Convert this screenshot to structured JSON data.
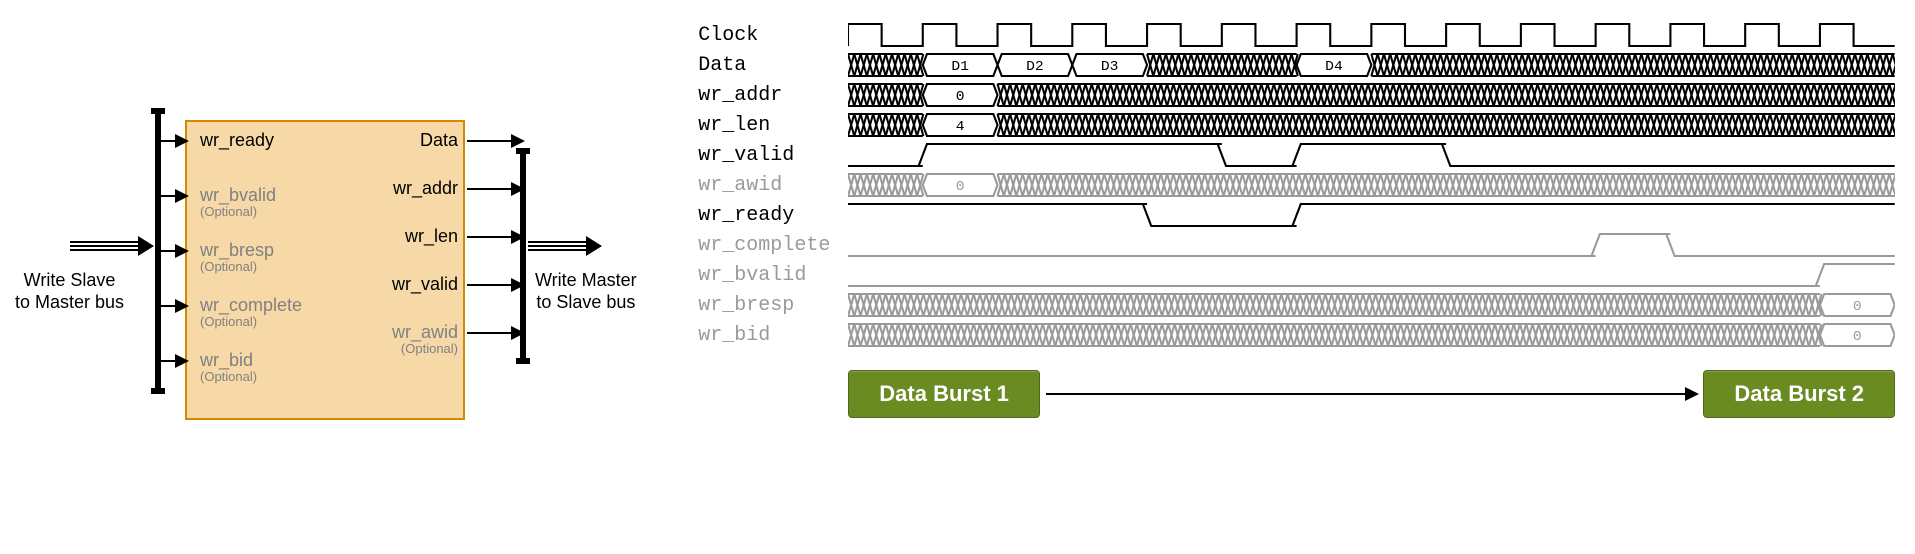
{
  "block": {
    "ext_in_label": "Write Slave\nto Master bus",
    "ext_out_label": "Write Master\nto Slave bus",
    "optional_text": "(Optional)",
    "inputs": [
      {
        "name": "wr_ready",
        "optional": false
      },
      {
        "name": "wr_bvalid",
        "optional": true
      },
      {
        "name": "wr_bresp",
        "optional": true
      },
      {
        "name": "wr_complete",
        "optional": true
      },
      {
        "name": "wr_bid",
        "optional": true
      }
    ],
    "outputs": [
      {
        "name": "Data",
        "optional": false
      },
      {
        "name": "wr_addr",
        "optional": false
      },
      {
        "name": "wr_len",
        "optional": false
      },
      {
        "name": "wr_valid",
        "optional": false
      },
      {
        "name": "wr_awid",
        "optional": true
      }
    ]
  },
  "timing": {
    "signals": [
      {
        "name": "Clock",
        "kind": "clock",
        "optional": false,
        "cycles": 14
      },
      {
        "name": "Data",
        "kind": "bus",
        "optional": false,
        "segments": [
          {
            "start": 0,
            "end": 1,
            "value": null
          },
          {
            "start": 1,
            "end": 2,
            "value": "D1"
          },
          {
            "start": 2,
            "end": 3,
            "value": "D2"
          },
          {
            "start": 3,
            "end": 4,
            "value": "D3"
          },
          {
            "start": 4,
            "end": 6,
            "value": null
          },
          {
            "start": 6,
            "end": 7,
            "value": "D4"
          },
          {
            "start": 7,
            "end": 14,
            "value": null
          }
        ]
      },
      {
        "name": "wr_addr",
        "kind": "bus",
        "optional": false,
        "segments": [
          {
            "start": 0,
            "end": 1,
            "value": null
          },
          {
            "start": 1,
            "end": 2,
            "value": "0"
          },
          {
            "start": 2,
            "end": 14,
            "value": null
          }
        ]
      },
      {
        "name": "wr_len",
        "kind": "bus",
        "optional": false,
        "segments": [
          {
            "start": 0,
            "end": 1,
            "value": null
          },
          {
            "start": 1,
            "end": 2,
            "value": "4"
          },
          {
            "start": 2,
            "end": 14,
            "value": null
          }
        ]
      },
      {
        "name": "wr_valid",
        "kind": "logic",
        "optional": false,
        "wave": "01111011000000"
      },
      {
        "name": "wr_awid",
        "kind": "bus",
        "optional": true,
        "segments": [
          {
            "start": 0,
            "end": 1,
            "value": null
          },
          {
            "start": 1,
            "end": 2,
            "value": "0"
          },
          {
            "start": 2,
            "end": 14,
            "value": null
          }
        ]
      },
      {
        "name": "wr_ready",
        "kind": "logic",
        "optional": false,
        "wave": "11110011111111"
      },
      {
        "name": "wr_complete",
        "kind": "logic",
        "optional": true,
        "wave": "00000000001000"
      },
      {
        "name": "wr_bvalid",
        "kind": "logic",
        "optional": true,
        "wave": "00000000000001"
      },
      {
        "name": "wr_bresp",
        "kind": "bus",
        "optional": true,
        "segments": [
          {
            "start": 0,
            "end": 13,
            "value": null
          },
          {
            "start": 13,
            "end": 14,
            "value": "0"
          }
        ]
      },
      {
        "name": "wr_bid",
        "kind": "bus",
        "optional": true,
        "segments": [
          {
            "start": 0,
            "end": 13,
            "value": null
          },
          {
            "start": 13,
            "end": 14,
            "value": "0"
          }
        ]
      }
    ],
    "bursts": [
      "Data Burst 1",
      "Data Burst 2"
    ]
  }
}
